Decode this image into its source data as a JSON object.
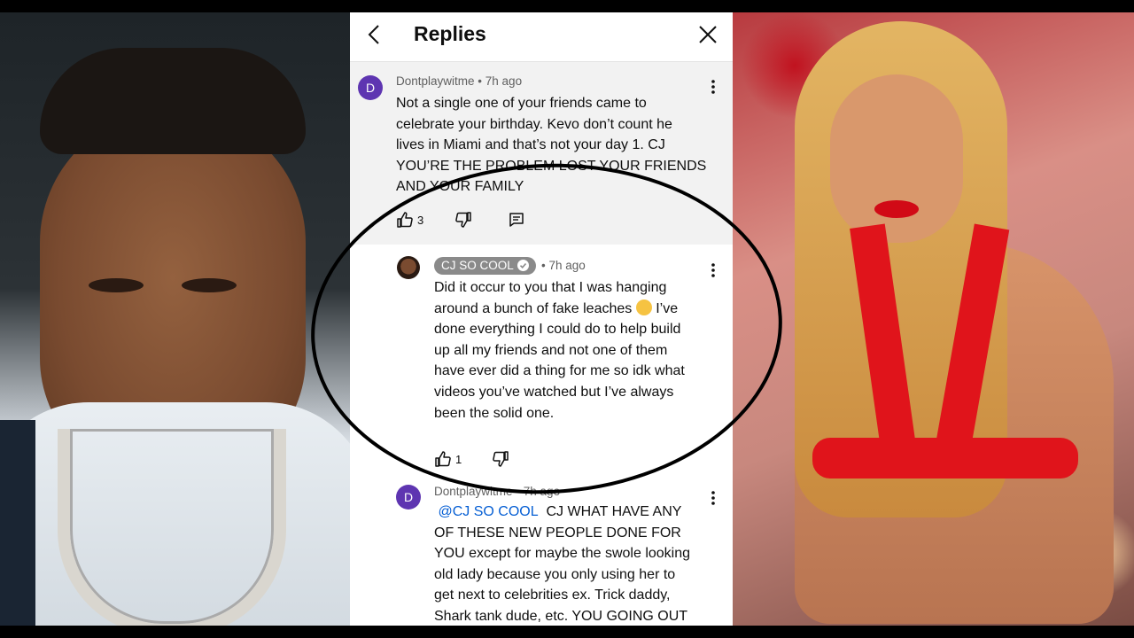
{
  "header": {
    "title": "Replies",
    "back_icon": "chevron-left-icon",
    "close_icon": "close-icon"
  },
  "comments": [
    {
      "avatar_letter": "D",
      "author": "Dontplaywitme",
      "time": "7h ago",
      "text_lines": [
        "Not a single one of your friends came to",
        "celebrate your birthday. Kevo don’t count he",
        "lives in Miami and that’s not your day 1. CJ",
        "YOU’RE THE PROBLEM LOST YOUR FRIENDS",
        "AND YOUR FAMILY"
      ],
      "likes": "3"
    },
    {
      "author": "CJ SO COOL",
      "time": "7h ago",
      "text_lines": [
        "Did it occur to you that I was hanging",
        "around a bunch of fake leaches",
        "I’ve",
        "done everything I could do to help build",
        "up all my friends and not one of them",
        "have ever did a thing for me so idk what",
        "videos you’ve watched but I’ve always",
        "been the solid one."
      ],
      "emoji": "thinking-face",
      "likes": "1"
    },
    {
      "avatar_letter": "D",
      "author": "Dontplaywitme",
      "time": "7h ago",
      "mention": "@CJ SO COOL",
      "text_lines": [
        "CJ WHAT HAVE ANY",
        "OF THESE NEW PEOPLE DONE FOR",
        "YOU except for maybe the swole looking",
        "old lady because you only using her to",
        "get next to celebrities ex. Trick daddy,",
        "Shark tank dude, etc. YOU GOING OUT"
      ]
    }
  ],
  "colors": {
    "accent_avatar": "#5e35b1",
    "mention": "#065fd4",
    "parent_bg": "#f2f2f2"
  }
}
